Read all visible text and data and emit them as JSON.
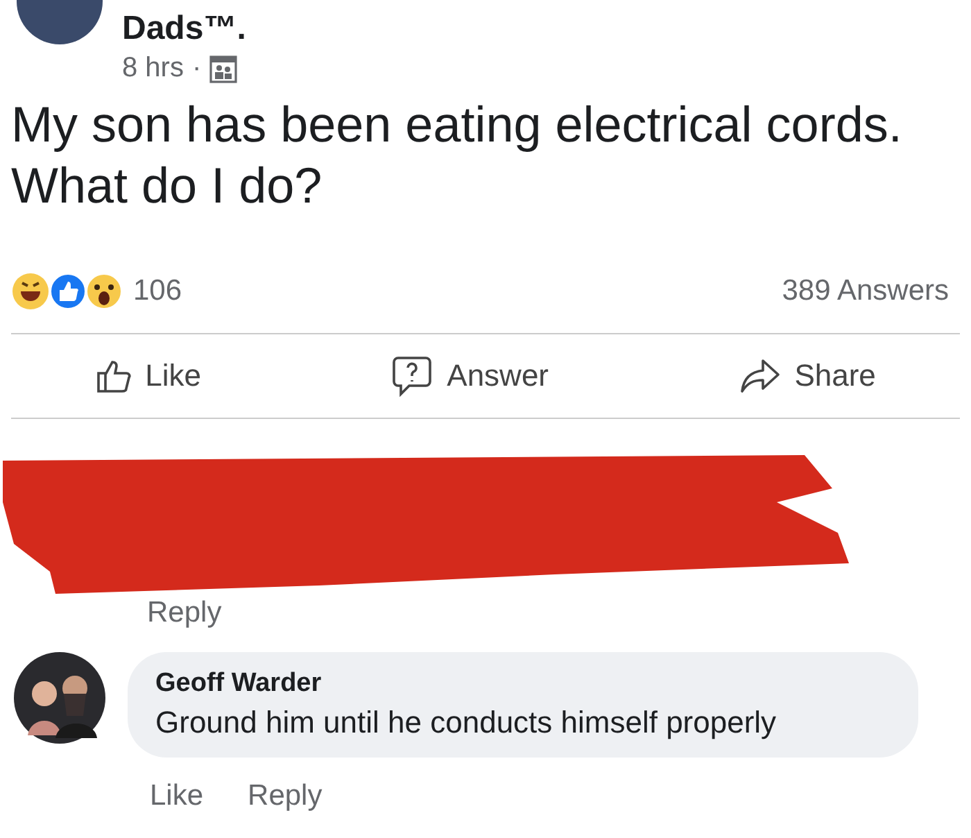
{
  "post": {
    "author": "Dads™.",
    "time": "8 hrs",
    "separator": "·",
    "text": "My son has been eating electrical cords. What do I do?",
    "reaction_count": "106",
    "answers_count": "389 Answers"
  },
  "actions": [
    {
      "kind": "like",
      "label": "Like"
    },
    {
      "kind": "answer",
      "label": "Answer"
    },
    {
      "kind": "share",
      "label": "Share"
    }
  ],
  "redacted_comment": {
    "actions": [
      "Reply"
    ]
  },
  "comment": {
    "author": "Geoff Warder",
    "text": "Ground him until he conducts himself properly",
    "actions": [
      "Like",
      "Reply"
    ]
  }
}
